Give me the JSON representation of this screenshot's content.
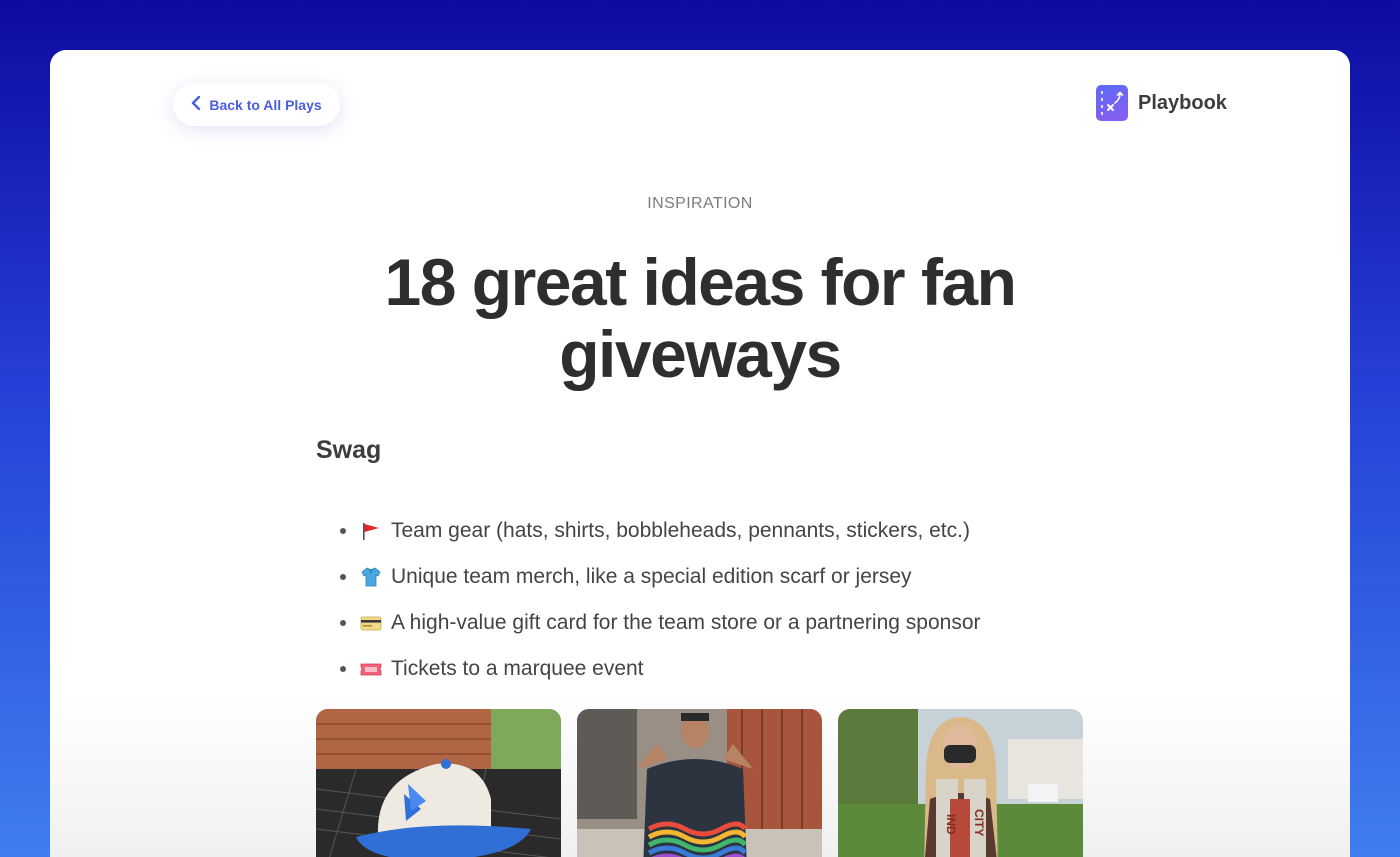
{
  "nav": {
    "back_label": "Back to All Plays",
    "brand_name": "Playbook"
  },
  "article": {
    "eyebrow": "INSPIRATION",
    "title_line1": "18 great ideas for fan",
    "title_line2": "giveways",
    "section_heading": "Swag",
    "items": [
      {
        "icon": "flag-icon",
        "text": "Team gear (hats, shirts, bobbleheads, pennants, stickers, etc.)"
      },
      {
        "icon": "shirt-icon",
        "text": "Unique team merch, like a special edition scarf or jersey"
      },
      {
        "icon": "credit-card-icon",
        "text": "A high-value gift card for the team store or a partnering sponsor"
      },
      {
        "icon": "ticket-icon",
        "text": "Tickets to a marquee event"
      }
    ],
    "images": [
      {
        "name": "cap-photo"
      },
      {
        "name": "jersey-photo"
      },
      {
        "name": "scarf-photo"
      }
    ]
  },
  "colors": {
    "accent": "#4a5ee0",
    "background_top": "#0e0aa0",
    "background_bottom": "#3f7ef0",
    "title": "#2e2e2e"
  }
}
